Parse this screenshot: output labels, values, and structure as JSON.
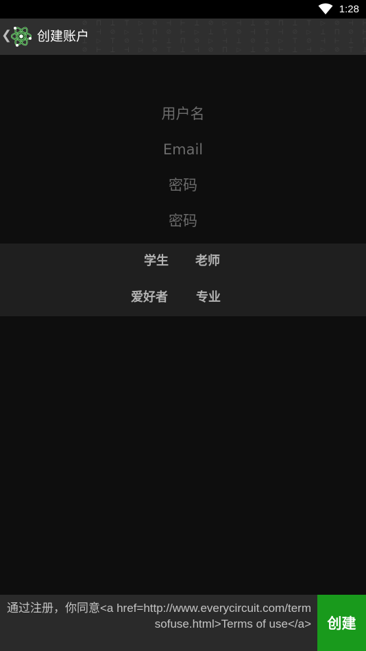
{
  "status_bar": {
    "time": "1:28",
    "wifi_icon": "wifi-icon"
  },
  "action_bar": {
    "back_icon": "chevron-left-icon",
    "logo_icon": "everycircuit-logo-icon",
    "title": "创建账户",
    "background_color": "#2f2f2f"
  },
  "form": {
    "username": {
      "placeholder": "用户名",
      "value": ""
    },
    "email": {
      "placeholder": "Email",
      "value": ""
    },
    "password": {
      "placeholder": "密码",
      "value": ""
    },
    "password_confirm": {
      "placeholder": "密码",
      "value": ""
    }
  },
  "roles": {
    "student": "学生",
    "teacher": "老师",
    "hobbyist": "爱好者",
    "professional": "专业"
  },
  "footer": {
    "terms_text": "通过注册，你同意<a href=http://www.everycircuit.com/termsofuse.html>Terms of use</a>",
    "create_label": "创建",
    "create_color": "#199a1c"
  }
}
